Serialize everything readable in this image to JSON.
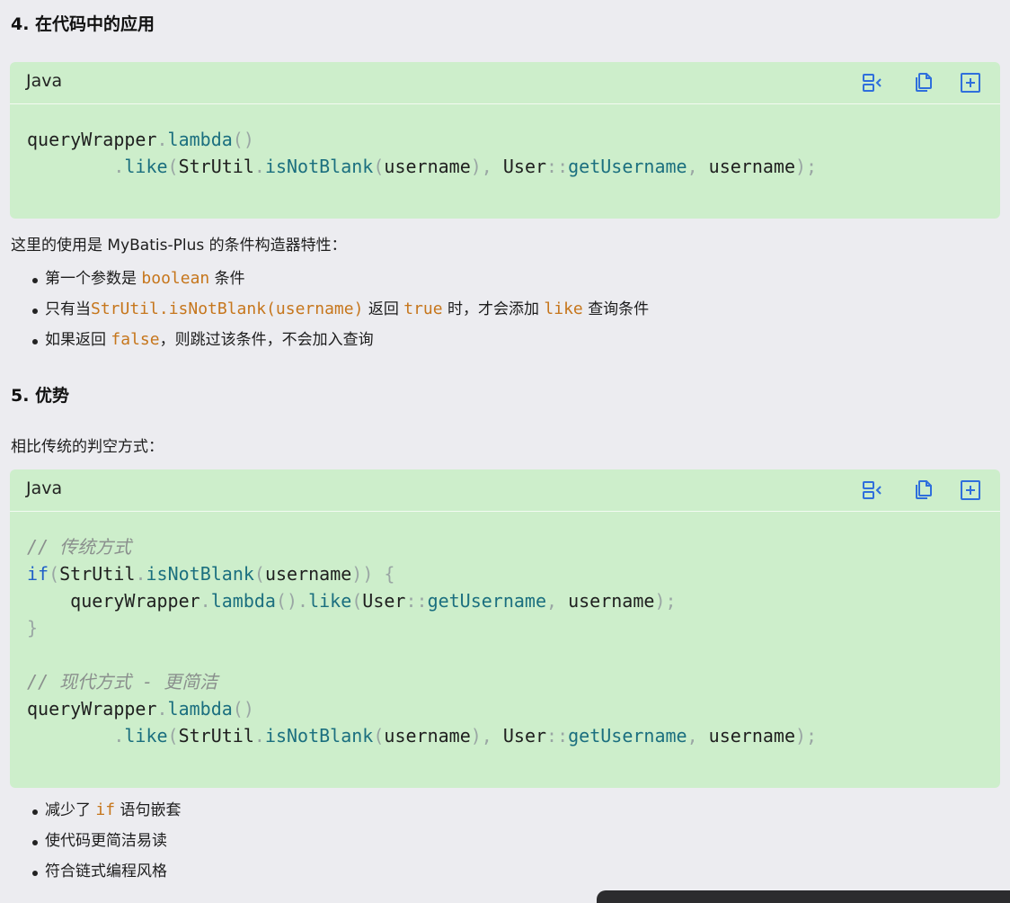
{
  "section4": {
    "title": "4. 在代码中的应用"
  },
  "code1": {
    "lang": "Java"
  },
  "para1": "这里的使用是 MyBatis-Plus 的条件构造器特性：",
  "list1": {
    "i1_pre": "第一个参数是",
    "i1_code": "boolean",
    "i1_post": "条件",
    "i2_pre": "只有当",
    "i2_code1": "StrUtil.isNotBlank(username)",
    "i2_mid1": "返回",
    "i2_code2": "true",
    "i2_mid2": "时，才会添加",
    "i2_code3": "like",
    "i2_post": "查询条件",
    "i3_pre": "如果返回",
    "i3_code": "false",
    "i3_post": "，则跳过该条件，不会加入查询"
  },
  "section5": {
    "title": "5. 优势"
  },
  "para2": "相比传统的判空方式：",
  "code2": {
    "lang": "Java",
    "comment1": "// 传统方式",
    "comment2": "// 现代方式 - 更简洁"
  },
  "list2": {
    "i1_pre": "减少了",
    "i1_code": "if",
    "i1_post": "语句嵌套",
    "i2": "使代码更简洁易读",
    "i3": "符合链式编程风格"
  },
  "toolbar": {
    "icons": [
      "wrap-lines-icon",
      "copy-icon",
      "expand-icon"
    ]
  },
  "colors": {
    "code_bg": "#cdeecb",
    "page_bg": "#ececf0",
    "icon_blue": "#2f6fdc",
    "inline_code": "#c6761c"
  }
}
